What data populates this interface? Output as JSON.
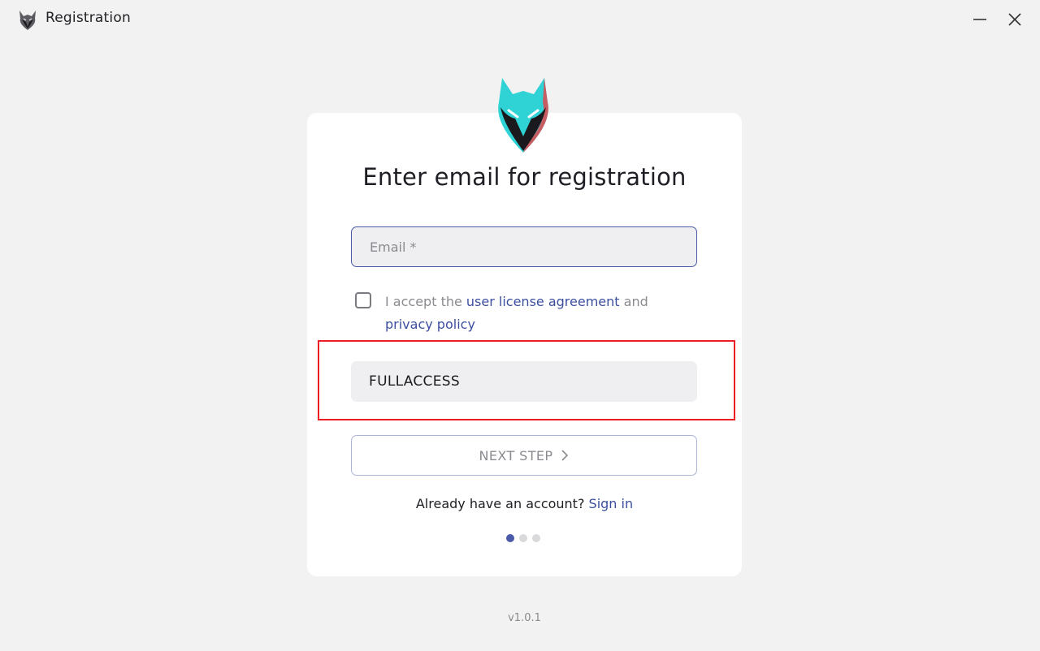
{
  "window": {
    "title": "Registration",
    "minimize_icon": "minimize-icon",
    "close_icon": "close-icon"
  },
  "form": {
    "heading": "Enter email for registration",
    "email_placeholder": "Email *",
    "email_value": "",
    "consent": {
      "prefix": "I accept the ",
      "license_link": "user license agreement",
      "middle": " and",
      "privacy_link": "privacy policy",
      "checked": false
    },
    "promo_code_value": "FULLACCESS",
    "next_button_label": "NEXT STEP",
    "signin_prompt": "Already have an account?",
    "signin_link": "Sign in",
    "steps": {
      "total": 3,
      "current": 1
    }
  },
  "footer": {
    "version": "v1.0.1"
  },
  "colors": {
    "accent": "#4a5aa8",
    "link": "#3c4f9f",
    "highlight_border": "#ee1c24",
    "logo_teal": "#2fd3d6"
  }
}
